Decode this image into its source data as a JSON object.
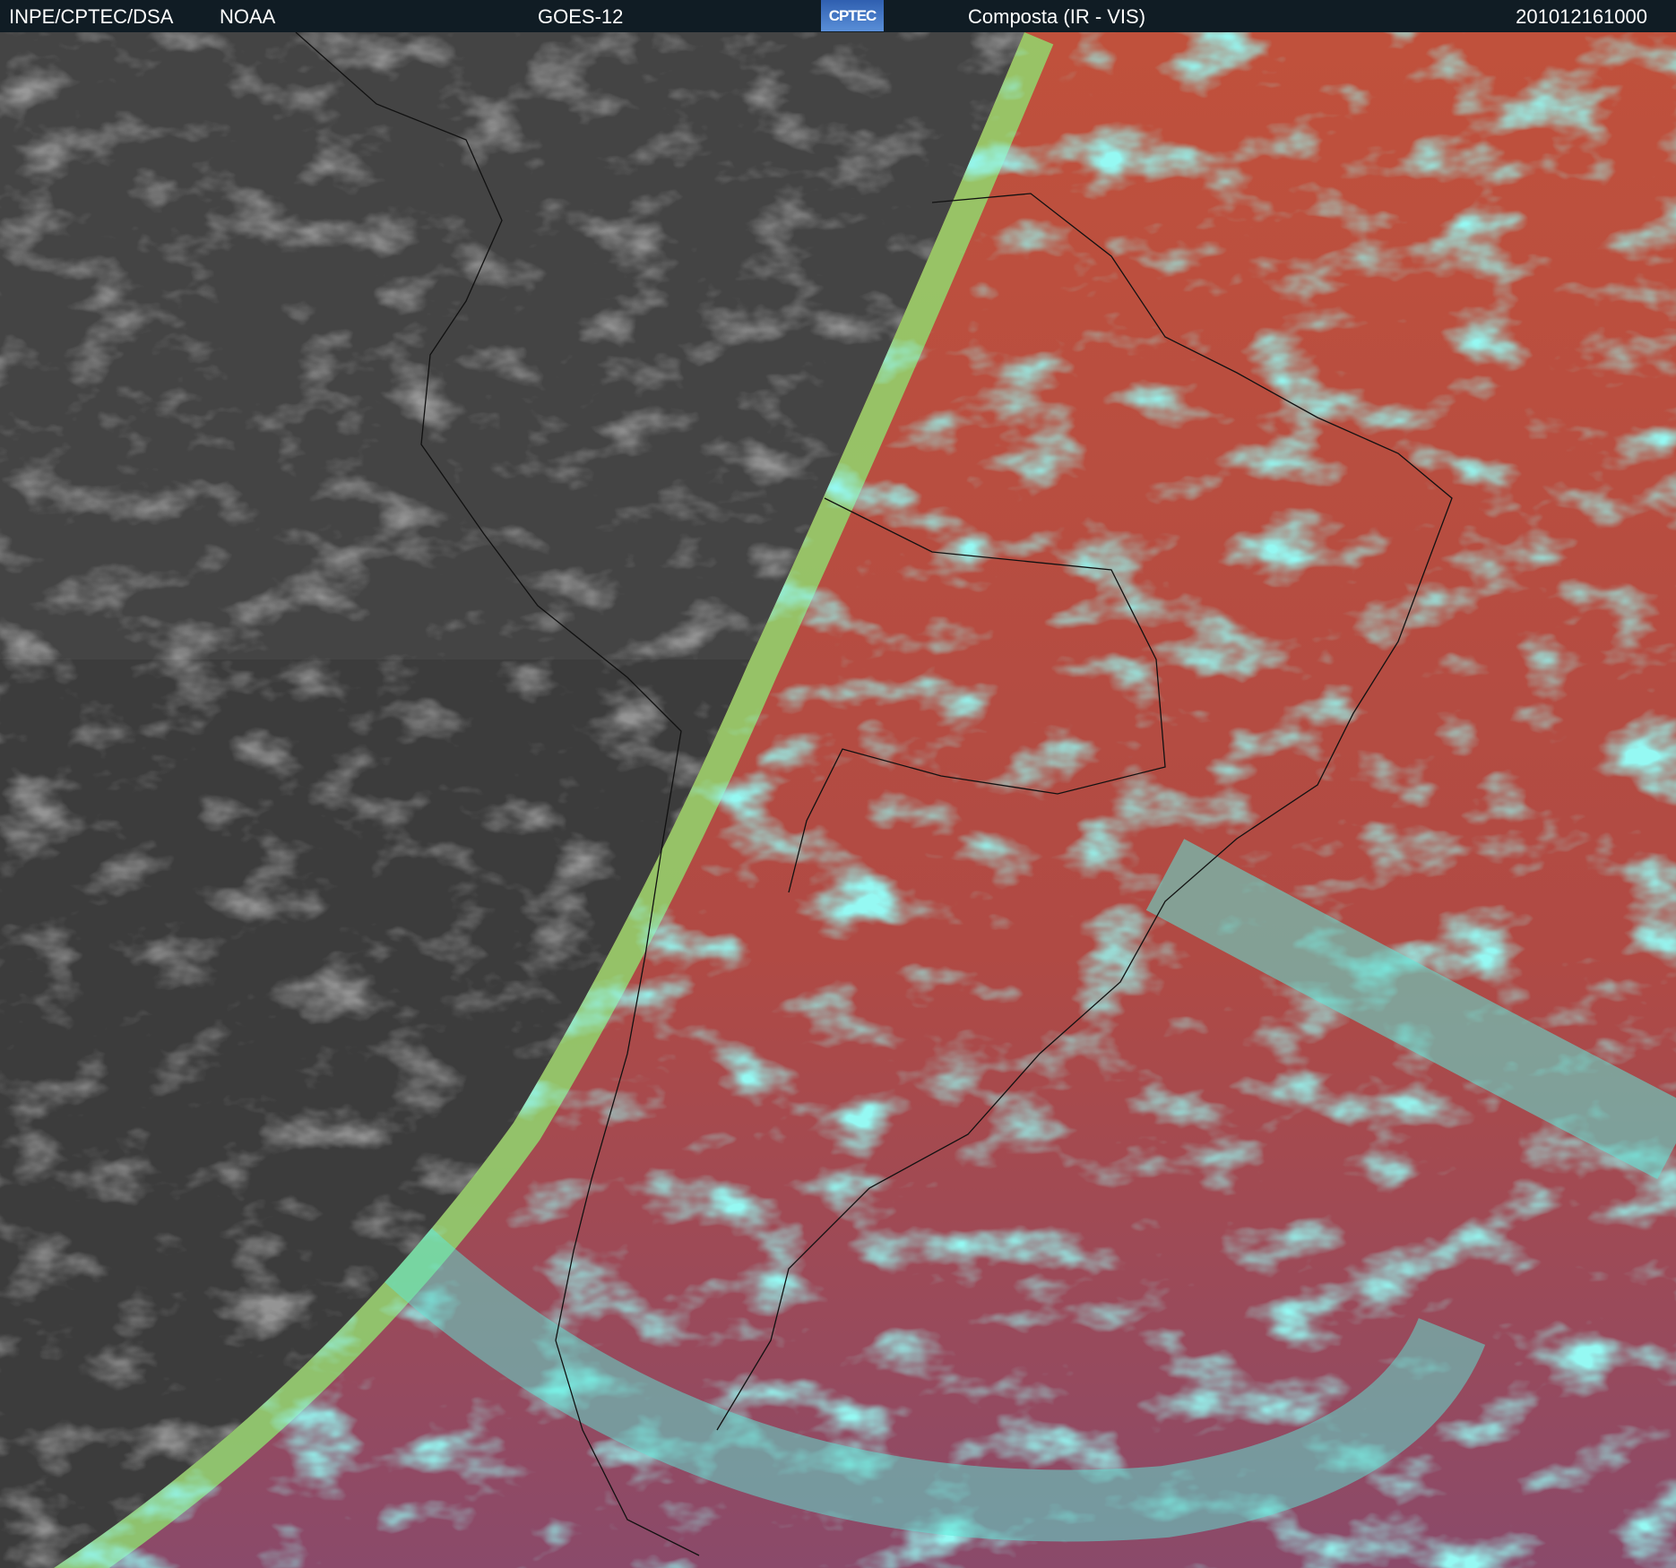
{
  "header": {
    "org": "INPE/CPTEC/DSA",
    "agency": "NOAA",
    "satellite": "GOES-12",
    "logo_text": "CPTEC",
    "product": "Composta (IR - VIS)",
    "timestamp": "201012161000"
  },
  "colors": {
    "header_bg": "#101c24",
    "night_gray": "#3a3a3a",
    "day_red": "#b2503f",
    "cloud_cyan": "#4fe6e0",
    "terminator_green": "#8ee070"
  }
}
